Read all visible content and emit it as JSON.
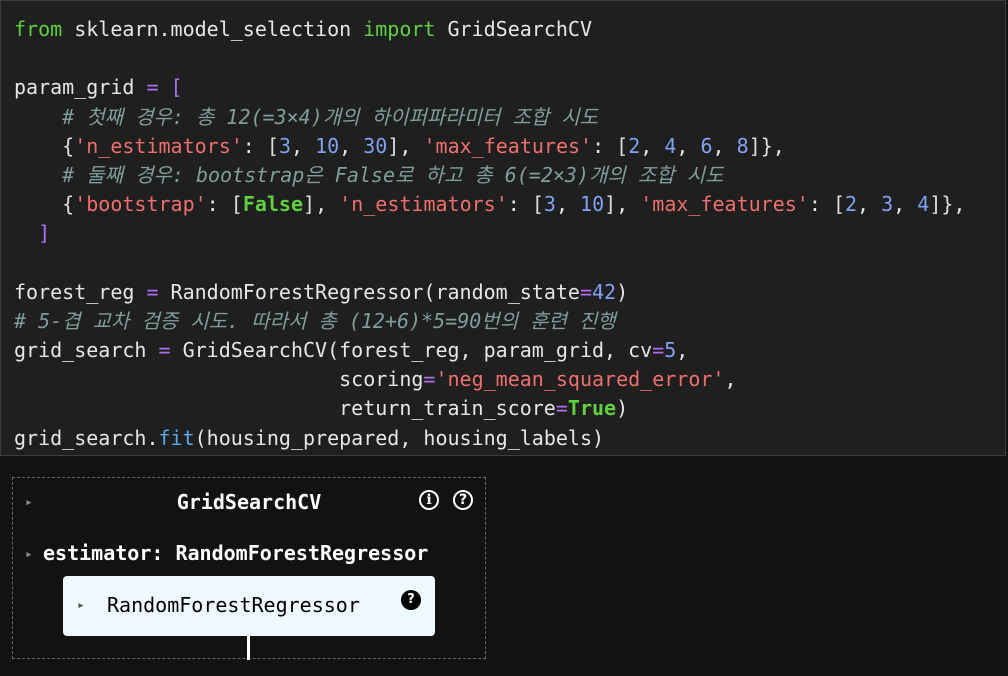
{
  "code_cell": {
    "lines": [
      [
        [
          "kw",
          "from"
        ],
        [
          "t",
          " sklearn.model_selection "
        ],
        [
          "kw",
          "import"
        ],
        [
          "t",
          " GridSearchCV"
        ]
      ],
      [],
      [
        [
          "t",
          "param_grid "
        ],
        [
          "op",
          "="
        ],
        [
          "t",
          " "
        ],
        [
          "op",
          "["
        ]
      ],
      [
        [
          "t",
          "    "
        ],
        [
          "comment",
          "# 첫째 경우: 총 12(=3×4)개의 하이퍼파라미터 조합 시도"
        ]
      ],
      [
        [
          "t",
          "    "
        ],
        [
          "br",
          "{"
        ],
        [
          "str",
          "'n_estimators'"
        ],
        [
          "t",
          ": "
        ],
        [
          "br",
          "["
        ],
        [
          "num",
          "3"
        ],
        [
          "t",
          ", "
        ],
        [
          "num",
          "10"
        ],
        [
          "t",
          ", "
        ],
        [
          "num",
          "30"
        ],
        [
          "br",
          "]"
        ],
        [
          "t",
          ", "
        ],
        [
          "str",
          "'max_features'"
        ],
        [
          "t",
          ": "
        ],
        [
          "br",
          "["
        ],
        [
          "num",
          "2"
        ],
        [
          "t",
          ", "
        ],
        [
          "num",
          "4"
        ],
        [
          "t",
          ", "
        ],
        [
          "num",
          "6"
        ],
        [
          "t",
          ", "
        ],
        [
          "num",
          "8"
        ],
        [
          "br",
          "]"
        ],
        [
          "br",
          "}"
        ],
        [
          "t",
          ","
        ]
      ],
      [
        [
          "t",
          "    "
        ],
        [
          "comment",
          "# 둘째 경우: bootstrap은 False로 하고 총 6(=2×3)개의 조합 시도"
        ]
      ],
      [
        [
          "t",
          "    "
        ],
        [
          "br",
          "{"
        ],
        [
          "str",
          "'bootstrap'"
        ],
        [
          "t",
          ": "
        ],
        [
          "br",
          "["
        ],
        [
          "bool",
          "False"
        ],
        [
          "br",
          "]"
        ],
        [
          "t",
          ", "
        ],
        [
          "str",
          "'n_estimators'"
        ],
        [
          "t",
          ": "
        ],
        [
          "br",
          "["
        ],
        [
          "num",
          "3"
        ],
        [
          "t",
          ", "
        ],
        [
          "num",
          "10"
        ],
        [
          "br",
          "]"
        ],
        [
          "t",
          ", "
        ],
        [
          "str",
          "'max_features'"
        ],
        [
          "t",
          ": "
        ],
        [
          "br",
          "["
        ],
        [
          "num",
          "2"
        ],
        [
          "t",
          ", "
        ],
        [
          "num",
          "3"
        ],
        [
          "t",
          ", "
        ],
        [
          "num",
          "4"
        ],
        [
          "br",
          "]"
        ],
        [
          "br",
          "}"
        ],
        [
          "t",
          ","
        ]
      ],
      [
        [
          "t",
          "  "
        ],
        [
          "op",
          "]"
        ]
      ],
      [],
      [
        [
          "t",
          "forest_reg "
        ],
        [
          "op",
          "="
        ],
        [
          "t",
          " RandomForestRegressor(random_state"
        ],
        [
          "op",
          "="
        ],
        [
          "num",
          "42"
        ],
        [
          "t",
          ")"
        ]
      ],
      [
        [
          "comment",
          "# 5-겹 교차 검증 시도. 따라서 총 (12+6)*5=90번의 훈련 진행"
        ]
      ],
      [
        [
          "t",
          "grid_search "
        ],
        [
          "op",
          "="
        ],
        [
          "t",
          " GridSearchCV(forest_reg, param_grid, cv"
        ],
        [
          "op",
          "="
        ],
        [
          "num",
          "5"
        ],
        [
          "t",
          ","
        ]
      ],
      [
        [
          "t",
          "                           scoring"
        ],
        [
          "op",
          "="
        ],
        [
          "str",
          "'neg_mean_squared_error'"
        ],
        [
          "t",
          ","
        ]
      ],
      [
        [
          "t",
          "                           return_train_score"
        ],
        [
          "op",
          "="
        ],
        [
          "bool",
          "True"
        ],
        [
          "t",
          ")"
        ]
      ],
      [
        [
          "t",
          "grid_search."
        ],
        [
          "fn",
          "fit"
        ],
        [
          "t",
          "(housing_prepared, housing_labels)"
        ]
      ]
    ]
  },
  "output": {
    "gridsearch": {
      "title": "GridSearchCV",
      "expand_arrow": "▸",
      "info_icon": "i",
      "help_icon": "?"
    },
    "estimator": {
      "arrow": "▸",
      "label": "estimator: RandomForestRegressor"
    },
    "random_forest": {
      "arrow": "▸",
      "label": "RandomForestRegressor",
      "help_icon": "?"
    }
  },
  "colors": {
    "cell_bg": "#1f1f1f",
    "output_bg": "#121212",
    "keyword": "#5fd141",
    "operator": "#b06ef0",
    "string": "#ef6f6c",
    "number": "#7fa2f2",
    "comment": "#7f9e9b",
    "function": "#5aa8e8",
    "estimator_box": "#f0f8ff"
  }
}
